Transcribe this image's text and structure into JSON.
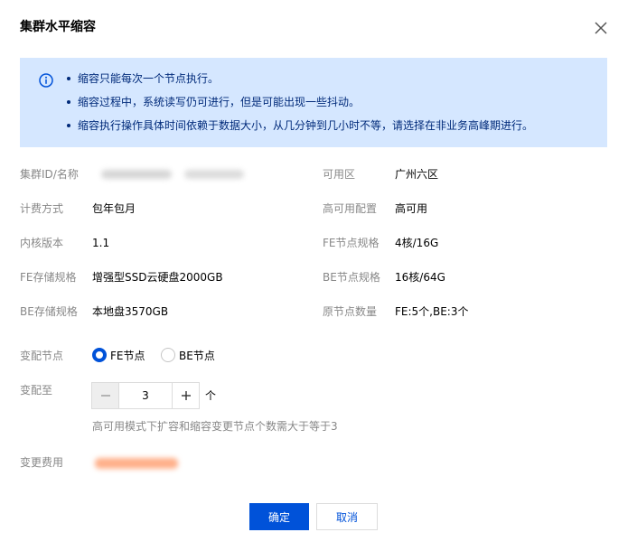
{
  "dialog": {
    "title": "集群水平缩容",
    "close_icon": "close-icon"
  },
  "notice": {
    "icon": "info-icon",
    "tips": [
      "缩容只能每次一个节点执行。",
      "缩容过程中，系统读写仍可进行，但是可能出现一些抖动。",
      "缩容执行操作具体时间依赖于数据大小，从几分钟到几小时不等，请选择在非业务高峰期进行。"
    ]
  },
  "info": {
    "left": [
      {
        "label": "集群ID/名称",
        "value": ""
      },
      {
        "label": "计费方式",
        "value": "包年包月"
      },
      {
        "label": "内核版本",
        "value": "1.1"
      },
      {
        "label": "FE存储规格",
        "value": "增强型SSD云硬盘2000GB"
      },
      {
        "label": "BE存储规格",
        "value": "本地盘3570GB"
      }
    ],
    "right": [
      {
        "label": "可用区",
        "value": "广州六区"
      },
      {
        "label": "高可用配置",
        "value": "高可用"
      },
      {
        "label": "FE节点规格",
        "value": "4核/16G"
      },
      {
        "label": "BE节点规格",
        "value": "16核/64G"
      },
      {
        "label": "原节点数量",
        "value": "FE:5个,BE:3个"
      }
    ]
  },
  "form": {
    "node_label": "变配节点",
    "node_options": [
      {
        "label": "FE节点",
        "checked": true
      },
      {
        "label": "BE节点",
        "checked": false
      }
    ],
    "target_label": "变配至",
    "target_value": "3",
    "unit": "个",
    "hint": "高可用模式下扩容和缩容变更节点个数需大于等于3",
    "fee_label": "变更费用"
  },
  "footer": {
    "ok_label": "确定",
    "cancel_label": "取消"
  },
  "colors": {
    "primary": "#0052d9",
    "notice_bg": "#d5e7ff",
    "notice_text": "#002a7a",
    "label": "#888888"
  }
}
